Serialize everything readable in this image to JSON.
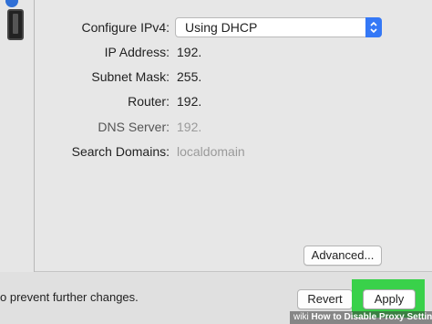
{
  "network": {
    "configure_label": "Configure IPv4:",
    "configure_value": "Using DHCP",
    "ip_label": "IP Address:",
    "ip_value": "192.",
    "subnet_label": "Subnet Mask:",
    "subnet_value": "255.",
    "router_label": "Router:",
    "router_value": "192.",
    "dns_label": "DNS Server:",
    "dns_value": "192.",
    "search_label": "Search Domains:",
    "search_value": "localdomain"
  },
  "buttons": {
    "advanced": "Advanced...",
    "revert": "Revert",
    "apply": "Apply"
  },
  "lock_text": "o prevent further changes.",
  "watermark": {
    "brand": "wiki",
    "title": "How to Disable Proxy Settings"
  },
  "colors": {
    "highlight": "#39d14a",
    "select_accent": "#3478f6"
  },
  "icons": {
    "sidebar_device": "phone-icon",
    "select_arrows": "up-down-chevron-icon"
  }
}
